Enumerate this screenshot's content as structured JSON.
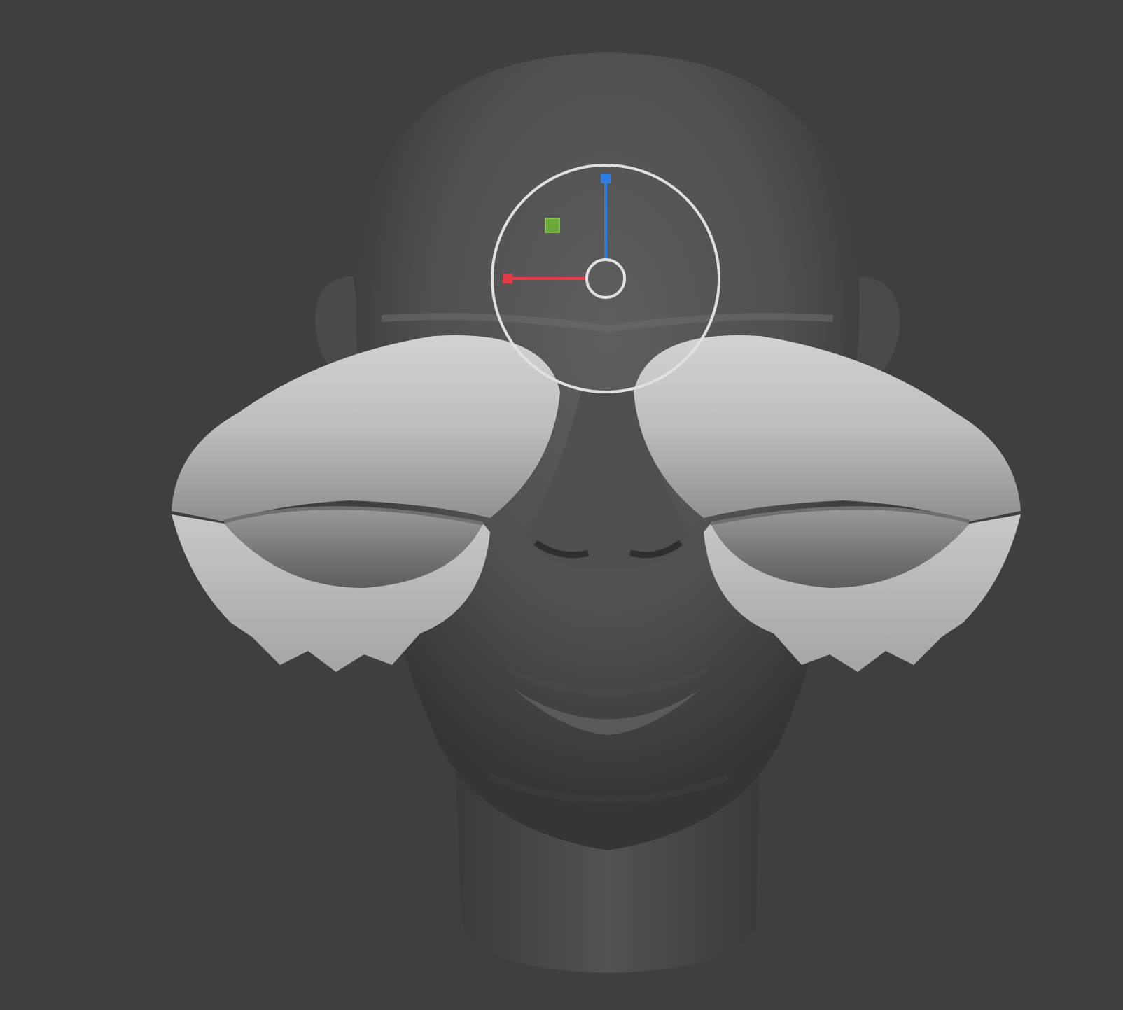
{
  "viewport": {
    "background_color": "#3f3f3f"
  },
  "model": {
    "description_name": "sculpted-head-mesh",
    "head_color": "#565656",
    "eyelid_color": "#bcbcbc"
  },
  "gizmo": {
    "ring_color": "#e0e0e0",
    "x_axis_color": "#e23a46",
    "y_axis_color": "#2f7de1",
    "z_handle_color": "#6aa63a"
  }
}
